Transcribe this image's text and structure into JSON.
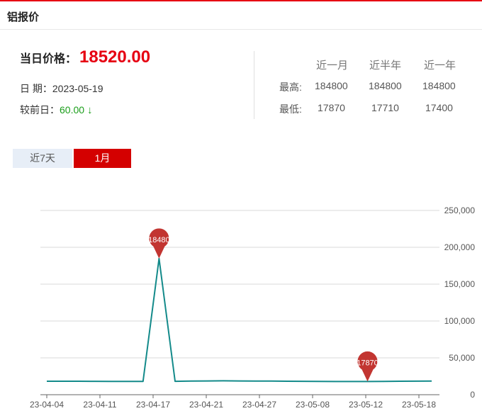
{
  "header": {
    "title": "铝报价"
  },
  "price": {
    "label": "当日价格：",
    "value": "18520.00"
  },
  "date": {
    "label": "日 期：",
    "value": "2023-05-19"
  },
  "change": {
    "label": "较前日：",
    "value": "60.00",
    "arrow": "↓"
  },
  "stats": {
    "columns": [
      "近一月",
      "近半年",
      "近一年"
    ],
    "rows": [
      {
        "label": "最高:",
        "values": [
          "184800",
          "184800",
          "184800"
        ]
      },
      {
        "label": "最低:",
        "values": [
          "17870",
          "17710",
          "17400"
        ]
      }
    ]
  },
  "tabs": [
    {
      "label": "近7天",
      "active": false
    },
    {
      "label": "1月",
      "active": true
    }
  ],
  "colors": {
    "accent": "#e60012",
    "line": "#138a8a",
    "marker": "#c23531",
    "down": "#1a9e1a"
  },
  "chart_data": {
    "type": "line",
    "title": "",
    "xlabel": "",
    "ylabel": "",
    "x_ticks": [
      "23-04-04",
      "23-04-11",
      "23-04-17",
      "23-04-21",
      "23-04-27",
      "23-05-08",
      "23-05-12",
      "23-05-18"
    ],
    "y_ticks": [
      "0",
      "50,000",
      "100,000",
      "150,000",
      "200,000",
      "250,000"
    ],
    "ylim": [
      0,
      250000
    ],
    "grid": true,
    "series": [
      {
        "values": [
          18300,
          18300,
          18300,
          18200,
          18100,
          18000,
          18000,
          184800,
          18200,
          18500,
          18700,
          18800,
          18700,
          18600,
          18500,
          18300,
          18200,
          18000,
          17900,
          17900,
          17870,
          18100,
          18300,
          18400,
          18500
        ]
      }
    ],
    "markers": [
      {
        "label": "18480",
        "index": 7,
        "value": 184800
      },
      {
        "label": "17870",
        "index": 20,
        "value": 17870
      }
    ]
  }
}
